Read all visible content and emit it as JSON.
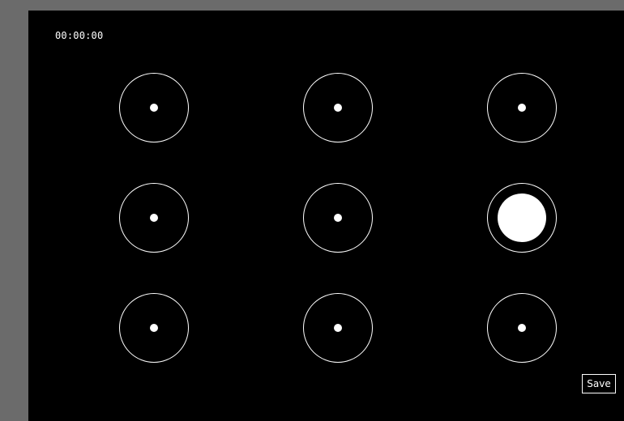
{
  "timer": {
    "text": "00:00:00"
  },
  "grid": {
    "rows": 3,
    "cols": 3,
    "active_target": {
      "row": 2,
      "col": 3
    },
    "targets": [
      {
        "row": 1,
        "col": 1,
        "active": false
      },
      {
        "row": 1,
        "col": 2,
        "active": false
      },
      {
        "row": 1,
        "col": 3,
        "active": false
      },
      {
        "row": 2,
        "col": 1,
        "active": false
      },
      {
        "row": 2,
        "col": 2,
        "active": false
      },
      {
        "row": 2,
        "col": 3,
        "active": true
      },
      {
        "row": 3,
        "col": 1,
        "active": false
      },
      {
        "row": 3,
        "col": 2,
        "active": false
      },
      {
        "row": 3,
        "col": 3,
        "active": false
      }
    ]
  },
  "save_button": {
    "label": "Save"
  },
  "colors": {
    "background": "#000000",
    "frame": "#6b6b6b",
    "foreground": "#ffffff"
  }
}
